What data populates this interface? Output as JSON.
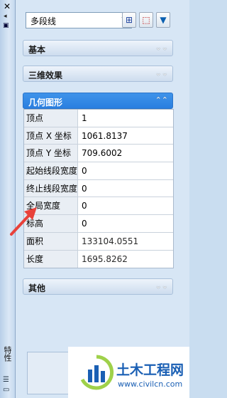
{
  "sidebar_strip": {
    "close_glyph": "✕",
    "vertical_title": "特性"
  },
  "toolbar": {
    "object_type": "多段线"
  },
  "sections": {
    "basic": "基本",
    "3d_effect": "三维效果",
    "geometry": "几何图形",
    "other": "其他"
  },
  "geometry_rows": [
    {
      "label": "顶点",
      "value": "1"
    },
    {
      "label": "顶点 X 坐标",
      "value": "1061.8137"
    },
    {
      "label": "顶点 Y 坐标",
      "value": "709.6002"
    },
    {
      "label": "起始线段宽度",
      "value": "0"
    },
    {
      "label": "终止线段宽度",
      "value": "0"
    },
    {
      "label": "全局宽度",
      "value": "0"
    },
    {
      "label": "标高",
      "value": "0"
    },
    {
      "label": "面积",
      "value": "133104.0551"
    },
    {
      "label": "长度",
      "value": "1695.8262"
    }
  ],
  "watermark": {
    "text": "土木工程网",
    "url": "www.civilcn.com"
  },
  "colors": {
    "section_active": "#2a7fe0",
    "annotation_arrow": "#e8413a",
    "watermark_blue": "#1a5fb4"
  }
}
